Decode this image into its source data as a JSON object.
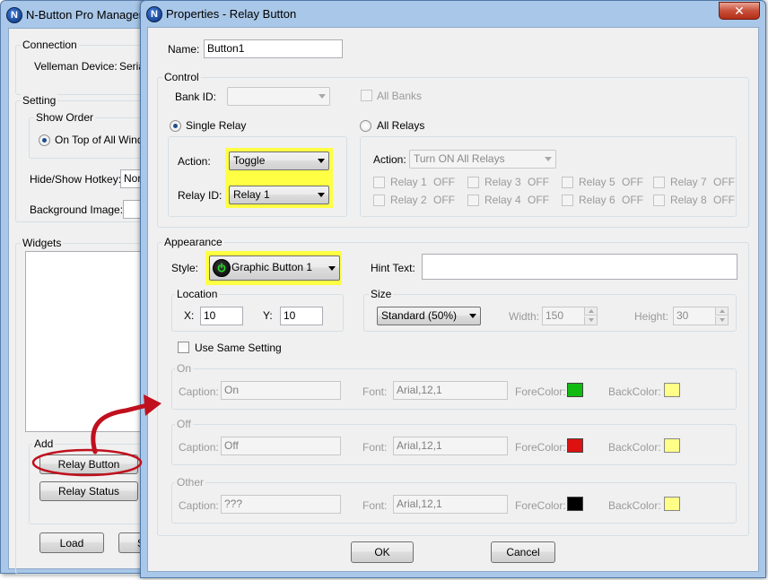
{
  "manager": {
    "title": "N-Button Pro Manager",
    "connection": {
      "label": "Connection",
      "device_label": "Velleman Device:",
      "device_value": "Seria"
    },
    "setting": {
      "label": "Setting",
      "show_order_label": "Show Order",
      "on_top_label": "On Top of All Windo",
      "hotkey_label": "Hide/Show Hotkey:",
      "hotkey_value": "Nor",
      "background_label": "Background Image:"
    },
    "widgets_label": "Widgets",
    "add": {
      "label": "Add",
      "relay_button": "Relay Button",
      "relay_status": "Relay Status"
    },
    "load_button": "Load",
    "save_button_fragment": "S"
  },
  "dialog": {
    "title": "Properties - Relay Button",
    "close_glyph": "✕",
    "name_label": "Name:",
    "name_value": "Button1",
    "control": {
      "label": "Control",
      "bank_id_label": "Bank ID:",
      "bank_id_value": "",
      "all_banks_label": "All Banks",
      "single_relay_label": "Single Relay",
      "all_relays_label": "All Relays",
      "action_label": "Action:",
      "action_value": "Toggle",
      "relay_id_label": "Relay ID:",
      "relay_id_value": "Relay 1",
      "all_action_label": "Action:",
      "all_action_value": "Turn ON All Relays",
      "relays": [
        {
          "label": "Relay 1",
          "state": "OFF"
        },
        {
          "label": "Relay 2",
          "state": "OFF"
        },
        {
          "label": "Relay 3",
          "state": "OFF"
        },
        {
          "label": "Relay 4",
          "state": "OFF"
        },
        {
          "label": "Relay 5",
          "state": "OFF"
        },
        {
          "label": "Relay 6",
          "state": "OFF"
        },
        {
          "label": "Relay 7",
          "state": "OFF"
        },
        {
          "label": "Relay 8",
          "state": "OFF"
        }
      ]
    },
    "appearance": {
      "label": "Appearance",
      "style_label": "Style:",
      "style_value": "Graphic Button 1",
      "hint_label": "Hint Text:",
      "hint_value": "",
      "location_label": "Location",
      "x_label": "X:",
      "x_value": "10",
      "y_label": "Y:",
      "y_value": "10",
      "size_label": "Size",
      "size_value": "Standard   (50%)",
      "width_label": "Width:",
      "width_value": "150",
      "height_label": "Height:",
      "height_value": "30",
      "same_setting_label": "Use Same Setting",
      "states": [
        {
          "group": "On",
          "caption_label": "Caption:",
          "caption": "On",
          "font_label": "Font:",
          "font": "Arial,12,1",
          "forecolor_label": "ForeColor:",
          "forecolor": "#11bb11",
          "backcolor_label": "BackColor:",
          "backcolor": "#ffff88"
        },
        {
          "group": "Off",
          "caption_label": "Caption:",
          "caption": "Off",
          "font_label": "Font:",
          "font": "Arial,12,1",
          "forecolor_label": "ForeColor:",
          "forecolor": "#dd1111",
          "backcolor_label": "BackColor:",
          "backcolor": "#ffff88"
        },
        {
          "group": "Other",
          "caption_label": "Caption:",
          "caption": "???",
          "font_label": "Font:",
          "font": "Arial,12,1",
          "forecolor_label": "ForeColor:",
          "forecolor": "#000000",
          "backcolor_label": "BackColor:",
          "backcolor": "#ffff88"
        }
      ]
    },
    "ok_button": "OK",
    "cancel_button": "Cancel"
  },
  "colors": {
    "highlight": "#ffff44",
    "annotation": "#c0101e",
    "title_bar": "#a9c7e8"
  }
}
